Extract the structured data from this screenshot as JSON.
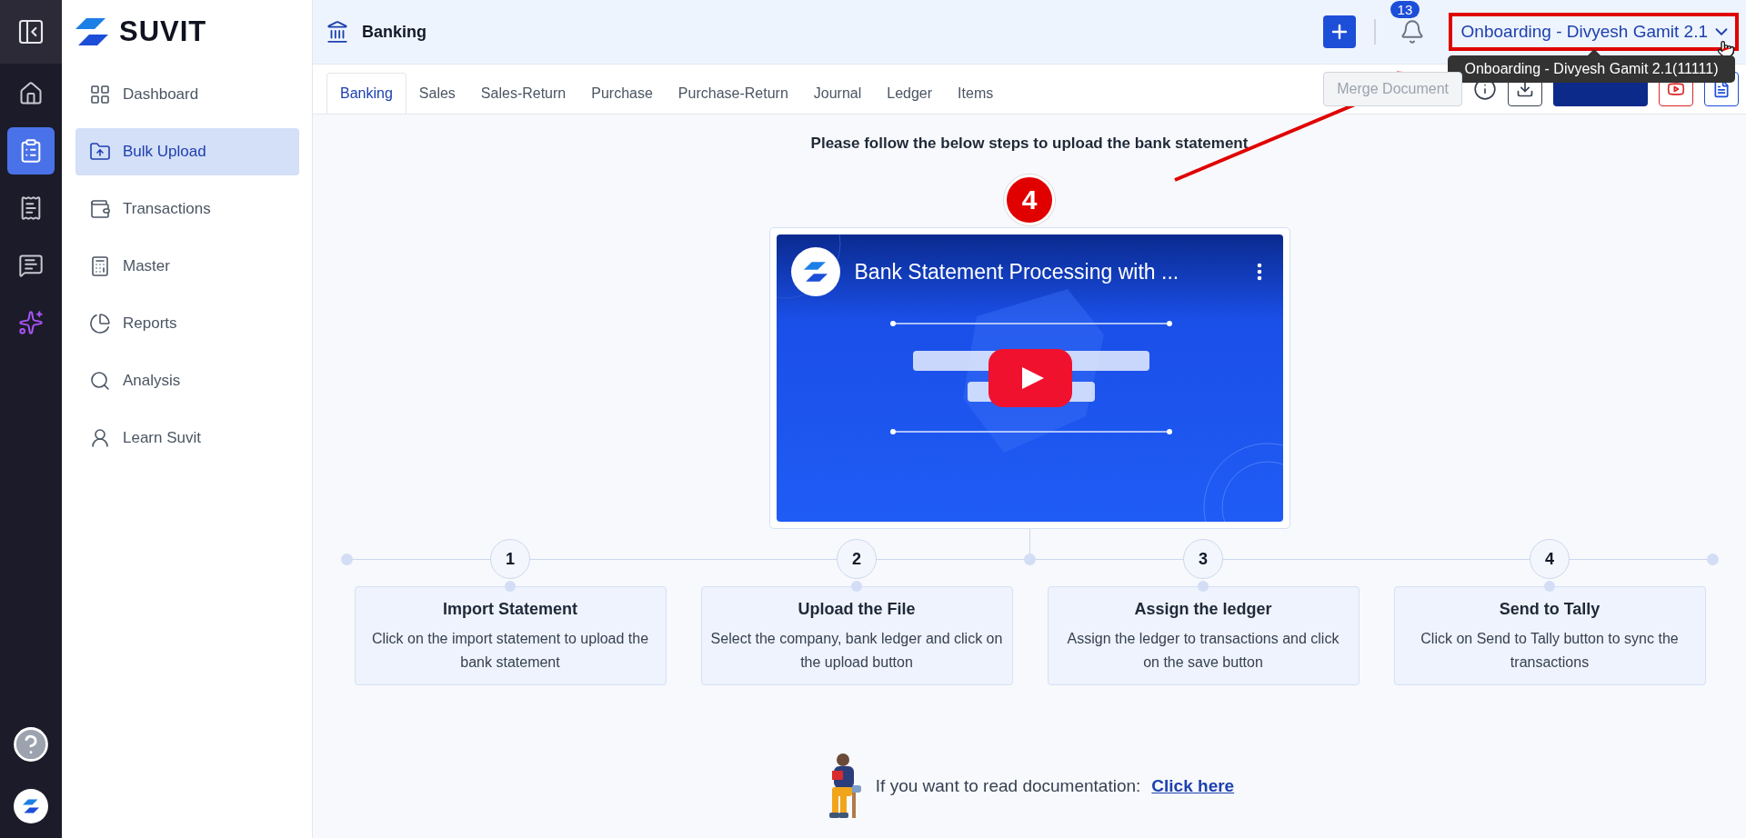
{
  "rail": {
    "items": [
      {
        "kind": "home",
        "selected": false
      },
      {
        "kind": "bulk",
        "selected": true
      },
      {
        "kind": "gst",
        "selected": false
      },
      {
        "kind": "chat",
        "selected": false
      },
      {
        "kind": "ai",
        "selected": false
      }
    ]
  },
  "sidebar": {
    "brand": "SUVIT",
    "items": [
      {
        "label": "Dashboard",
        "kind": "dashboard",
        "selected": false
      },
      {
        "label": "Bulk Upload",
        "kind": "upload",
        "selected": true
      },
      {
        "label": "Transactions",
        "kind": "transactions",
        "selected": false
      },
      {
        "label": "Master",
        "kind": "master",
        "selected": false
      },
      {
        "label": "Reports",
        "kind": "reports",
        "selected": false
      },
      {
        "label": "Analysis",
        "kind": "analysis",
        "selected": false
      },
      {
        "label": "Learn Suvit",
        "kind": "learn",
        "selected": false
      }
    ]
  },
  "header": {
    "title": "Banking",
    "notification_count": "13",
    "company": "Onboarding - Divyesh Gamit 2.1",
    "tooltip": "Onboarding - Divyesh Gamit 2.1(11111)"
  },
  "tabs": [
    {
      "label": "Banking",
      "selected": true
    },
    {
      "label": "Sales",
      "selected": false
    },
    {
      "label": "Sales-Return",
      "selected": false
    },
    {
      "label": "Purchase",
      "selected": false
    },
    {
      "label": "Purchase-Return",
      "selected": false
    },
    {
      "label": "Journal",
      "selected": false
    },
    {
      "label": "Ledger",
      "selected": false
    },
    {
      "label": "Items",
      "selected": false
    }
  ],
  "toolbar": {
    "merge_button": {
      "label": "Merge Document",
      "disabled": true
    }
  },
  "content": {
    "heading": "Please follow the below steps to upload the bank statement",
    "step_marker": "4",
    "video": {
      "title": "Bank Statement Processing with ..."
    },
    "steps": [
      {
        "number": "1",
        "title": "Import Statement",
        "description": "Click on the import statement to upload the bank statement"
      },
      {
        "number": "2",
        "title": "Upload the File",
        "description": "Select the company, bank ledger and click on the upload button"
      },
      {
        "number": "3",
        "title": "Assign the ledger",
        "description": "Assign the ledger to transactions and click on the save button"
      },
      {
        "number": "4",
        "title": "Send to Tally",
        "description": "Click on Send to Tally button to sync the transactions"
      }
    ],
    "docs": {
      "text": "If you want to read documentation:",
      "link": "Click here"
    }
  }
}
